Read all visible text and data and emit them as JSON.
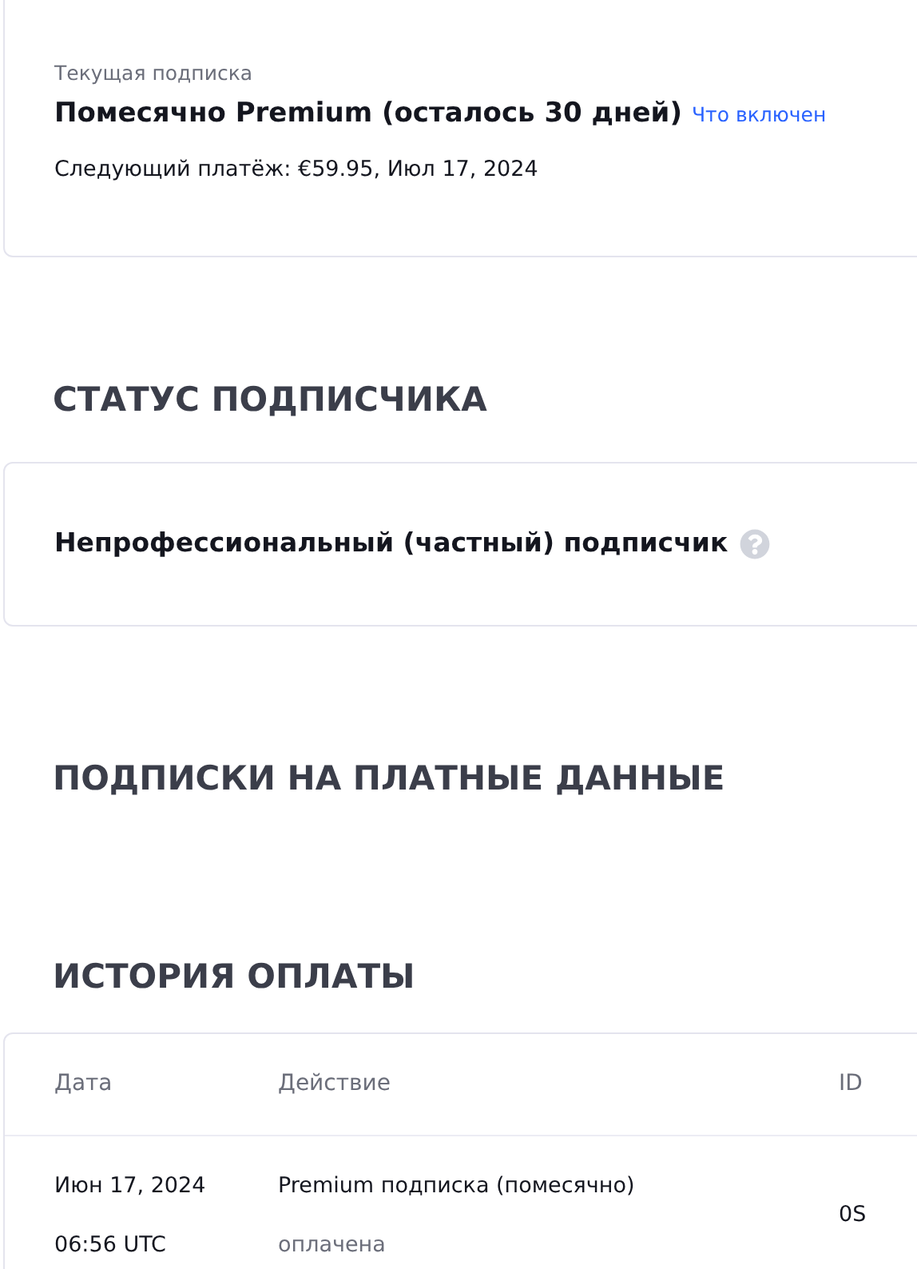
{
  "current_subscription": {
    "label": "Текущая подписка",
    "plan": "Помесячно Premium (осталось 30 дней)",
    "link": "Что включен",
    "next_payment": "Следующий платёж: €59.95, Июл 17, 2024"
  },
  "subscriber_status": {
    "heading": "СТАТУС ПОДПИСЧИКА",
    "value": "Непрофессиональный (частный) подписчик"
  },
  "paid_data": {
    "heading": "ПОДПИСКИ НА ПЛАТНЫЕ ДАННЫЕ"
  },
  "payment_history": {
    "heading": "ИСТОРИЯ ОПЛАТЫ",
    "columns": [
      "Дата",
      "Действие",
      "ID"
    ],
    "rows": [
      {
        "date": "Июн 17, 2024",
        "time": "06:56 UTC",
        "action": "Premium подписка (помесячно)",
        "status": "оплачена",
        "id": "0S"
      }
    ]
  }
}
